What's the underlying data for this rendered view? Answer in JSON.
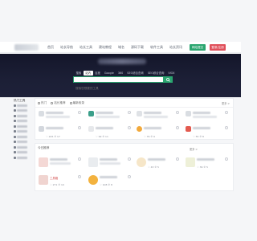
{
  "nav": {
    "links": [
      "首页",
      "站长导航",
      "站长工具",
      "建站教程",
      "域名",
      "源码下载",
      "软件工具",
      "站长资讯"
    ],
    "submit_label": "网站提交",
    "login_label": "登录/注册"
  },
  "search": {
    "tabs": [
      "搜索",
      "站内",
      "百度",
      "Google",
      "360",
      "SEO综合查询",
      "SEO综合查询",
      "VIOX"
    ],
    "placeholder": "搜索您想要的工具",
    "button_icon": "search-icon"
  },
  "sidebar": {
    "heading": "热门工具"
  },
  "panel1": {
    "tabs": [
      "热门",
      "站长推荐",
      "最新收录"
    ],
    "more": "更多 >"
  },
  "panel1_cards": [
    {
      "stat": "♡ 245   ⑨ 17"
    },
    {
      "stat": "♡ 99   ⑨ 11"
    },
    {
      "stat": "♡ 76   ⑨ 9"
    },
    {
      "stat": "♡ 55   ⑨ 8"
    }
  ],
  "panel2": {
    "title": "今日推荐",
    "more": "更多 >",
    "cards": [
      {
        "name": "工具箱",
        "stat": "♡ 271   ⑨ 10"
      },
      {
        "name": "",
        "stat": "♡ 108   ⑨ 8"
      },
      {
        "name": "",
        "stat": "♡ 43   ⑨ 5"
      },
      {
        "name": "",
        "stat": "♡ 39   ⑨ 5"
      }
    ]
  },
  "colors": {
    "accent_green": "#2aa56f",
    "accent_red": "#e04f5a",
    "hero_bg": "#1c1f36"
  }
}
